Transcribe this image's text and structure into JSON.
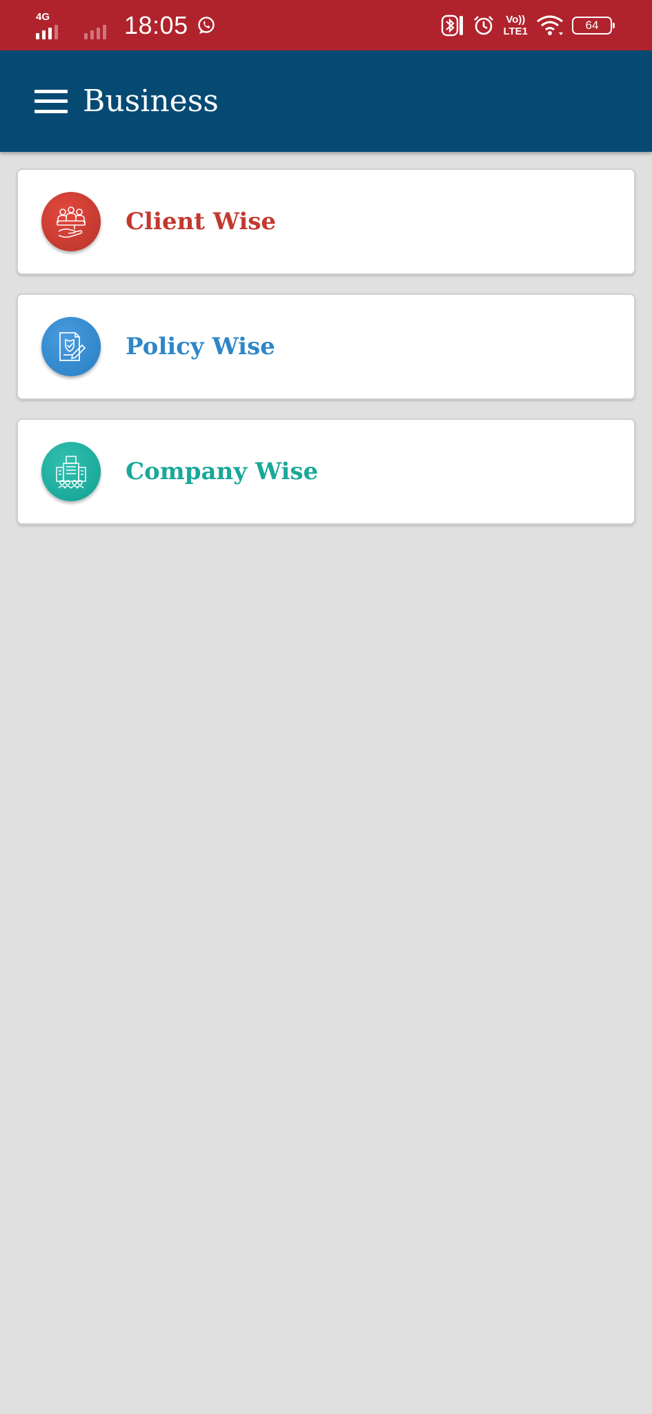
{
  "status_bar": {
    "network_label": "4G",
    "time": "18:05",
    "volte_top": "Vo))",
    "volte_bottom": "LTE1",
    "battery": "64",
    "icons": [
      "signal-icon",
      "whatsapp-icon",
      "bluetooth-icon",
      "alarm-icon",
      "wifi-icon",
      "battery-icon"
    ]
  },
  "app_bar": {
    "title": "Business",
    "menu_icon": "hamburger-menu-icon"
  },
  "colors": {
    "status_bar": "#b0232d",
    "app_bar": "#064a74",
    "background": "#e0e0e0",
    "client": "#c2392f",
    "policy": "#2e86c8",
    "company": "#1aa89a"
  },
  "cards": [
    {
      "label": "Client Wise",
      "icon": "clients-handshake-icon",
      "color": "#c2392f"
    },
    {
      "label": "Policy Wise",
      "icon": "policy-document-icon",
      "color": "#2e86c8"
    },
    {
      "label": "Company Wise",
      "icon": "company-building-icon",
      "color": "#1aa89a"
    }
  ]
}
